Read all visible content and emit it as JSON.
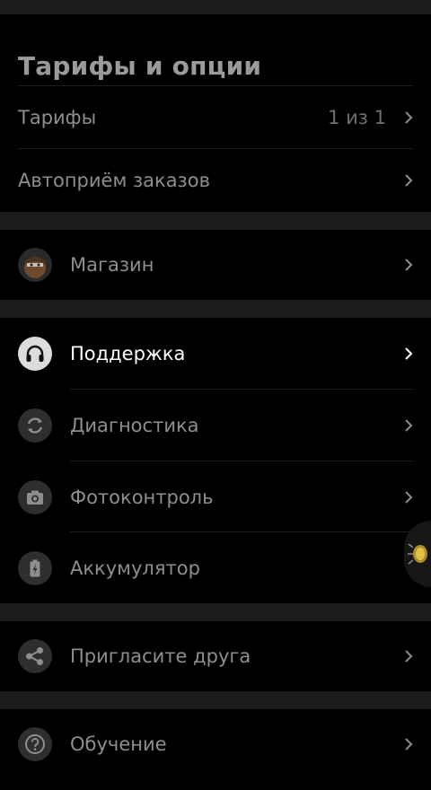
{
  "header": {
    "title": "Тарифы и опции"
  },
  "section_tariffs": {
    "rows": [
      {
        "label": "Тарифы",
        "value": "1 из 1"
      },
      {
        "label": "Автоприём заказов"
      }
    ]
  },
  "section_shop": {
    "rows": [
      {
        "label": "Магазин",
        "icon": "shop-avatar-icon"
      }
    ]
  },
  "section_tools": {
    "rows": [
      {
        "label": "Поддержка",
        "icon": "headphones-icon",
        "active": true
      },
      {
        "label": "Диагностика",
        "icon": "refresh-icon"
      },
      {
        "label": "Фотоконтроль",
        "icon": "camera-icon"
      },
      {
        "label": "Аккумулятор",
        "icon": "battery-icon"
      }
    ]
  },
  "section_invite": {
    "rows": [
      {
        "label": "Пригласите друга",
        "icon": "share-icon"
      }
    ]
  },
  "section_learning": {
    "rows": [
      {
        "label": "Обучение",
        "icon": "question-icon"
      }
    ]
  },
  "colors": {
    "background": "#000000",
    "gap": "#1b1b1b",
    "text_muted": "#8e8e8e",
    "text_active": "#ffffff",
    "icon_circle": "#2e2e2e"
  }
}
